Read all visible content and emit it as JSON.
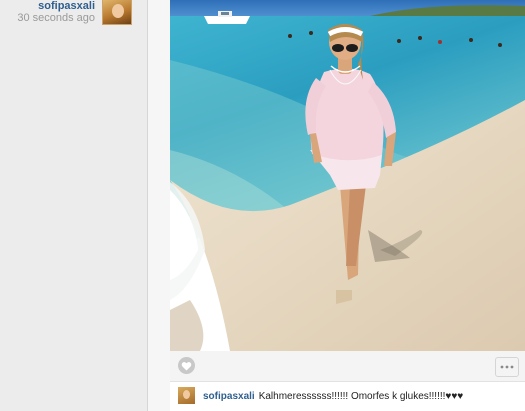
{
  "post": {
    "author": "sofipasxali",
    "time": "30 seconds ago"
  },
  "comments": [
    {
      "author": "sofipasxali",
      "text": "Kalhmeressssss!!!!!! Omorfes k glukes!!!!!!♥♥♥"
    }
  ],
  "icons": {
    "like": "heart-icon",
    "more": "more-dots-icon"
  },
  "colors": {
    "username": "#2f5f8f",
    "timestamp": "#9a9a9a",
    "sea": "#2fa7c8",
    "sand": "#e9dcc6"
  }
}
